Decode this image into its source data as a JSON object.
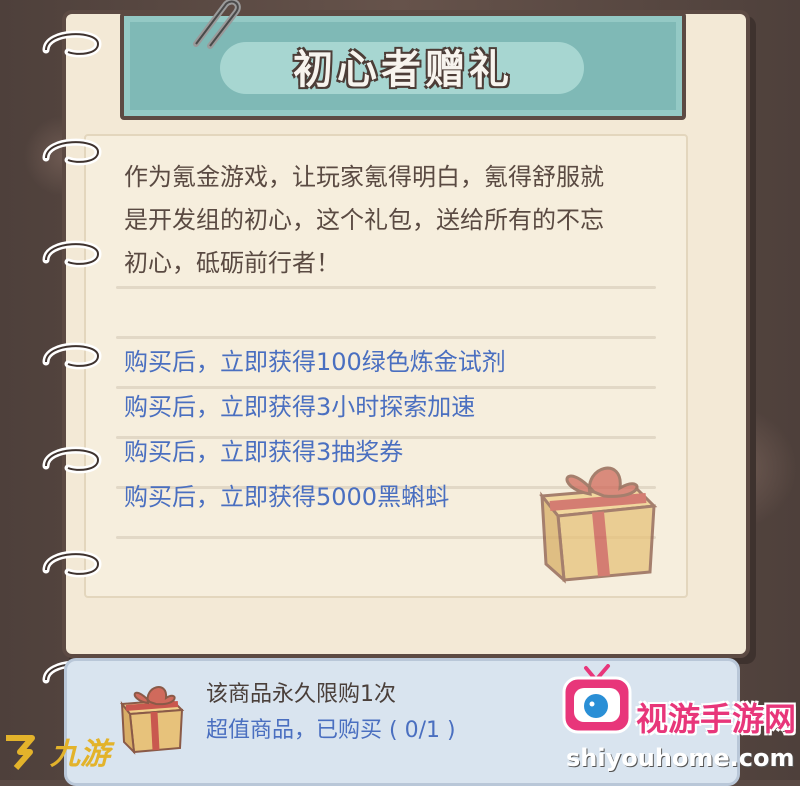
{
  "header": {
    "title": "初心者赠礼"
  },
  "description": {
    "lines": [
      "作为氪金游戏，让玩家氪得明白，氪得舒服就",
      "是开发组的初心，这个礼包，送给所有的不忘",
      "初心，砥砺前行者！"
    ]
  },
  "benefits": [
    "购买后，立即获得100绿色炼金试剂",
    "购买后，立即获得3小时探索加速",
    "购买后，立即获得3抽奖券",
    "购买后，立即获得5000黑蝌蚪"
  ],
  "purchase": {
    "limit_label": "该商品永久限购1次",
    "status_label": "超值商品，已购买 ( 0/1 )"
  },
  "watermarks": {
    "left_text": "九游",
    "right_name": "视游手游网",
    "right_url": "shiyouhome.com"
  },
  "icons": {
    "clip": "paper-clip-icon",
    "gift": "gift-box-icon",
    "tv": "tv-mascot-icon"
  },
  "colors": {
    "title_board": "#7fb9b6",
    "benefit_text": "#4a6fc0",
    "paper": "#f3e9d6",
    "frame": "#5c4a43"
  }
}
